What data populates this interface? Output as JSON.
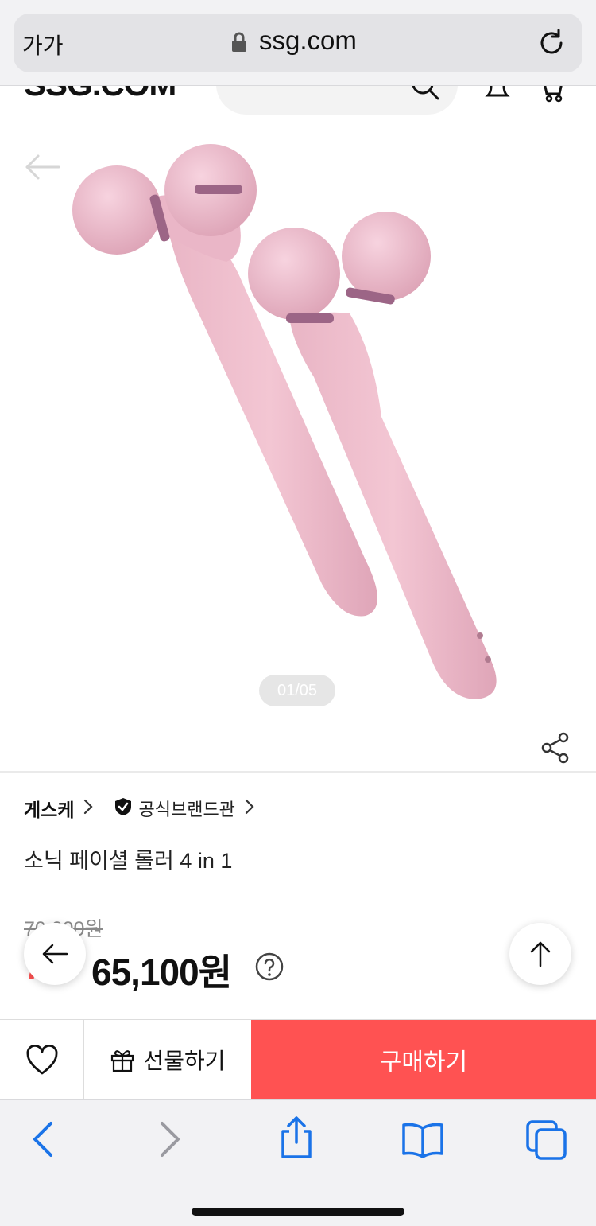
{
  "browser": {
    "text_size_label": "가가",
    "url": "ssg.com"
  },
  "site": {
    "logo": "SSG.COM"
  },
  "gallery": {
    "counter": "01/05",
    "image_subject": "pink facial roller devices",
    "accent_color": "#ff5252"
  },
  "product": {
    "brand": "게스케",
    "official_store": "공식브랜드관",
    "title": "소닉 페이셜 롤러 4 in 1",
    "original_price": "70,000원",
    "discount": "7%",
    "price": "65,100원"
  },
  "actions": {
    "gift_label": "선물하기",
    "buy_label": "구매하기"
  },
  "icons": [
    "lock-icon",
    "reload-icon",
    "search-icon",
    "bell-icon",
    "cart-icon",
    "back-arrow-icon",
    "share-icon",
    "chevron-right-icon",
    "verified-shield-icon",
    "help-icon",
    "arrow-up-icon",
    "heart-icon",
    "gift-icon",
    "safari-back-icon",
    "safari-forward-icon",
    "safari-share-icon",
    "bookmarks-icon",
    "tabs-icon"
  ]
}
